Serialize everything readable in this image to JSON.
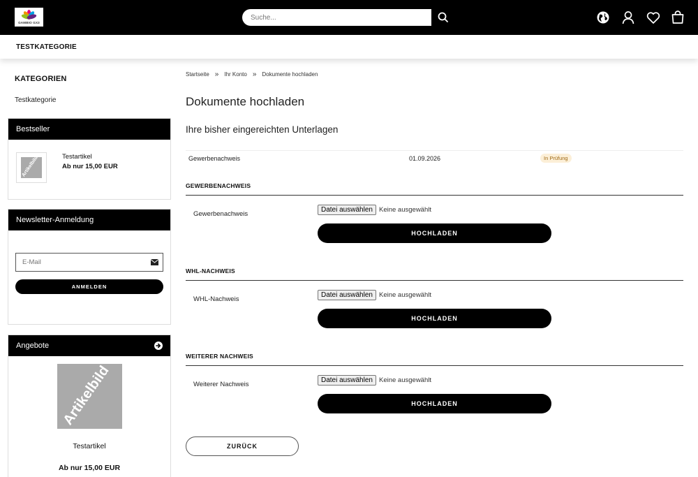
{
  "header": {
    "logo_text": "GAMBIO GX3",
    "search_placeholder": "Suche..."
  },
  "nav": {
    "items": [
      "TESTKATEGORIE"
    ]
  },
  "sidebar": {
    "categories_heading": "KATEGORIEN",
    "categories": [
      "Testkategorie"
    ],
    "bestseller": {
      "heading": "Bestseller",
      "product_name": "Testartikel",
      "product_price": "Ab nur 15,00 EUR",
      "image_label": "Artikelbild"
    },
    "newsletter": {
      "heading": "Newsletter-Anmeldung",
      "email_placeholder": "E-Mail",
      "submit_label": "ANMELDEN"
    },
    "offers": {
      "heading": "Angebote",
      "image_label": "Artikelbild",
      "product_name": "Testartikel",
      "product_price": "Ab nur 15,00 EUR"
    }
  },
  "breadcrumb": [
    "Startseite",
    "Ihr Konto",
    "Dokumente hochladen"
  ],
  "breadcrumb_separator": "»",
  "page_title": "Dokumente hochladen",
  "submitted_title": "Ihre bisher eingereichten Unterlagen",
  "submitted": [
    {
      "name": "Gewerbenachweis",
      "date": "01.09.2026",
      "status": "In Prüfung"
    }
  ],
  "sections": [
    {
      "heading": "GEWERBENACHWEIS",
      "label": "Gewerbenachweis",
      "file_button": "Datei auswählen",
      "file_status": "Keine ausgewählt",
      "upload_label": "HOCHLADEN"
    },
    {
      "heading": "WHL-NACHWEIS",
      "label": "WHL-Nachweis",
      "file_button": "Datei auswählen",
      "file_status": "Keine ausgewählt",
      "upload_label": "HOCHLADEN"
    },
    {
      "heading": "WEITERER NACHWEIS",
      "label": "Weiterer Nachweis",
      "file_button": "Datei auswählen",
      "file_status": "Keine ausgewählt",
      "upload_label": "HOCHLADEN"
    }
  ],
  "back_label": "ZURÜCK",
  "colors": {
    "header_bg": "#000000",
    "badge_bg": "#fcefd7",
    "badge_text": "#a06a16",
    "button_bg": "#000000"
  }
}
